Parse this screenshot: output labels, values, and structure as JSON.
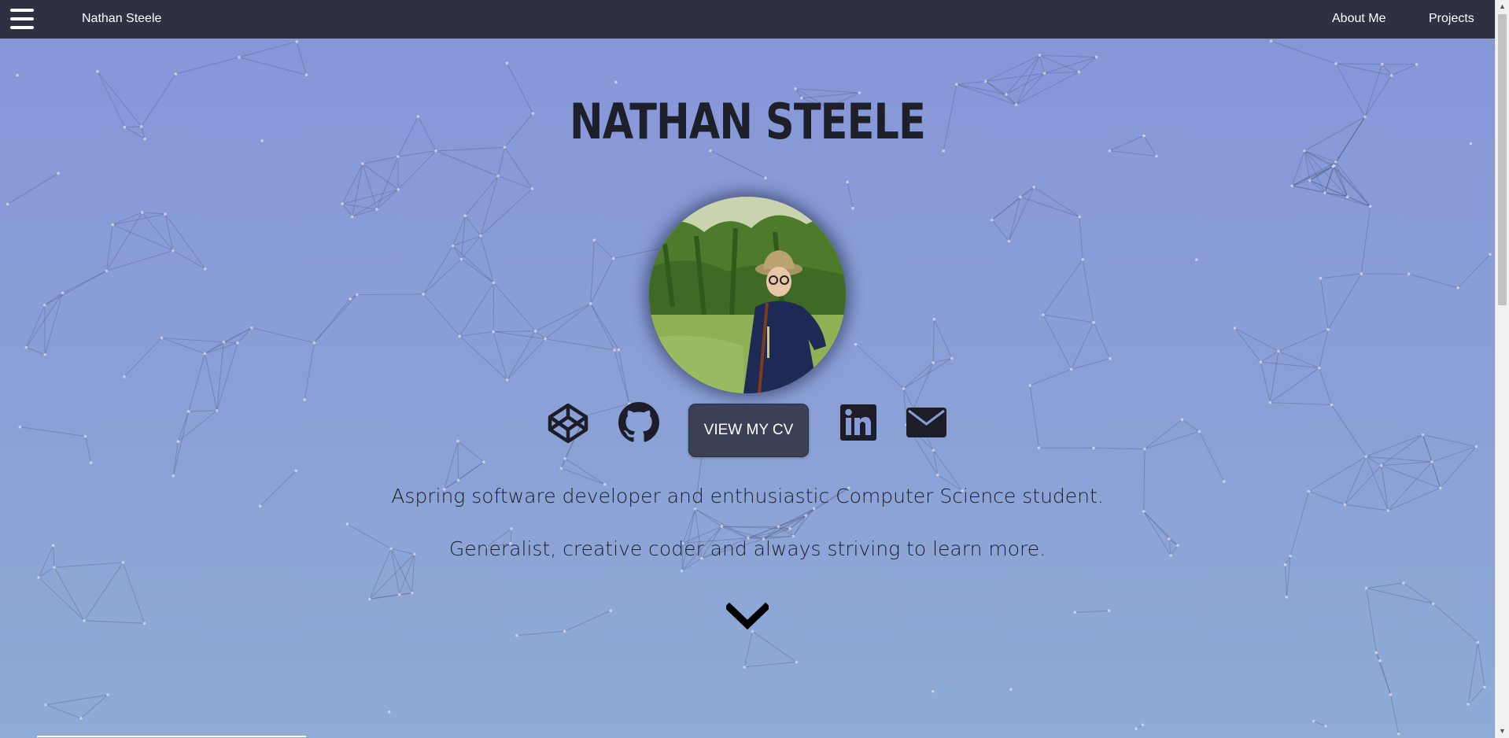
{
  "navbar": {
    "menu_icon": "hamburger-menu-icon",
    "brand": "Nathan Steele",
    "links": [
      {
        "label": "About Me"
      },
      {
        "label": "Projects"
      }
    ]
  },
  "hero": {
    "title": "NATHAN STEELE",
    "avatar_icon": "profile-photo",
    "socials": [
      {
        "icon": "codepen-icon"
      },
      {
        "icon": "github-icon"
      },
      {
        "icon": "linkedin-icon"
      },
      {
        "icon": "email-icon"
      }
    ],
    "cv_button": "VIEW MY CV",
    "tagline_1": "Aspring software developer and enthusiastic Computer Science student.",
    "tagline_2": "Generalist, creative coder and always striving to learn more.",
    "scroll_icon": "chevron-down-icon"
  },
  "colors": {
    "navbar_bg": "#2e3142",
    "background_top": "#8696d8",
    "background_bottom": "#8fabd6",
    "button_bg": "#3b4054",
    "text_dark": "#1e1f28"
  }
}
